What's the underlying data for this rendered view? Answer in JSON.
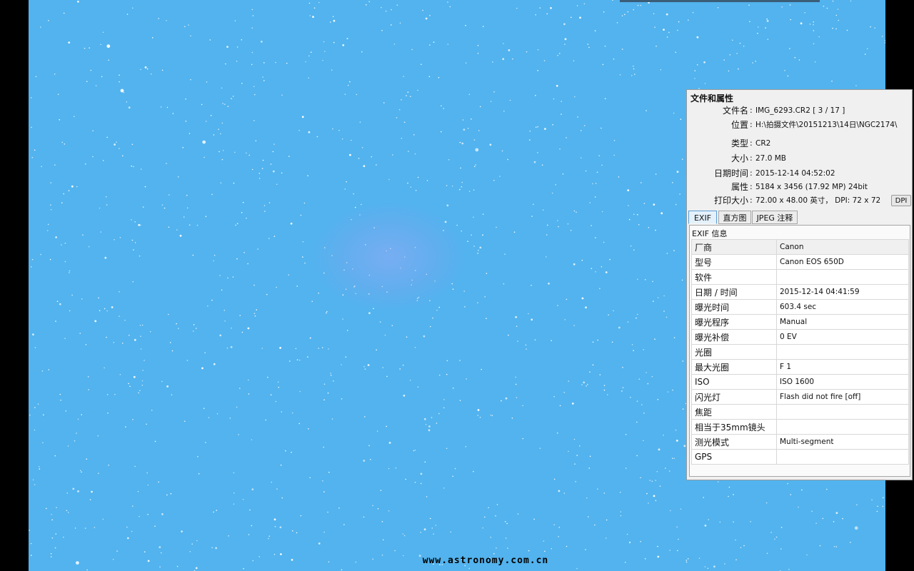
{
  "panel": {
    "title": "文件和属性",
    "properties": [
      {
        "key": "文件名",
        "value": "IMG_6293.CR2   [ 3 / 17 ]"
      },
      {
        "key": "位置",
        "value": "H:\\拍摄文件\\20151213\\14日\\NGC2174\\"
      },
      {
        "key": "类型",
        "value": "CR2"
      },
      {
        "key": "大小",
        "value": "27.0 MB"
      },
      {
        "key": "日期时间",
        "value": "2015-12-14 04:52:02"
      },
      {
        "key": "属性",
        "value": "5184 x 3456 (17.92 MP)  24bit"
      },
      {
        "key": "打印大小",
        "value": "72.00 x 48.00 英寸，  DPI: 72 x 72"
      }
    ],
    "dpi_button": "DPI",
    "tabs": [
      "EXIF",
      "直方图",
      "JPEG 注释"
    ],
    "exif_header": "EXIF 信息",
    "exif_rows": [
      {
        "key": "厂商",
        "value": "Canon"
      },
      {
        "key": "型号",
        "value": "Canon EOS 650D"
      },
      {
        "key": "软件",
        "value": ""
      },
      {
        "key": "日期 / 时间",
        "value": "2015-12-14 04:41:59"
      },
      {
        "key": "曝光时间",
        "value": "603.4 sec"
      },
      {
        "key": "曝光程序",
        "value": "Manual"
      },
      {
        "key": "曝光补偿",
        "value": "0 EV"
      },
      {
        "key": "光圈",
        "value": ""
      },
      {
        "key": "最大光圈",
        "value": "F 1"
      },
      {
        "key": "ISO",
        "value": "ISO 1600"
      },
      {
        "key": "闪光灯",
        "value": "Flash did not fire [off]"
      },
      {
        "key": "焦距",
        "value": ""
      },
      {
        "key": "相当于35mm镜头",
        "value": ""
      },
      {
        "key": "测光模式",
        "value": "Multi-segment"
      },
      {
        "key": "GPS",
        "value": ""
      }
    ]
  },
  "watermark": "www.astronomy.com.cn",
  "colors": {
    "sky": "#52b3ee",
    "nebula": "#96aaf5",
    "panel_bg": "#f0f0f0",
    "tab_active": "#5b9bd5"
  }
}
